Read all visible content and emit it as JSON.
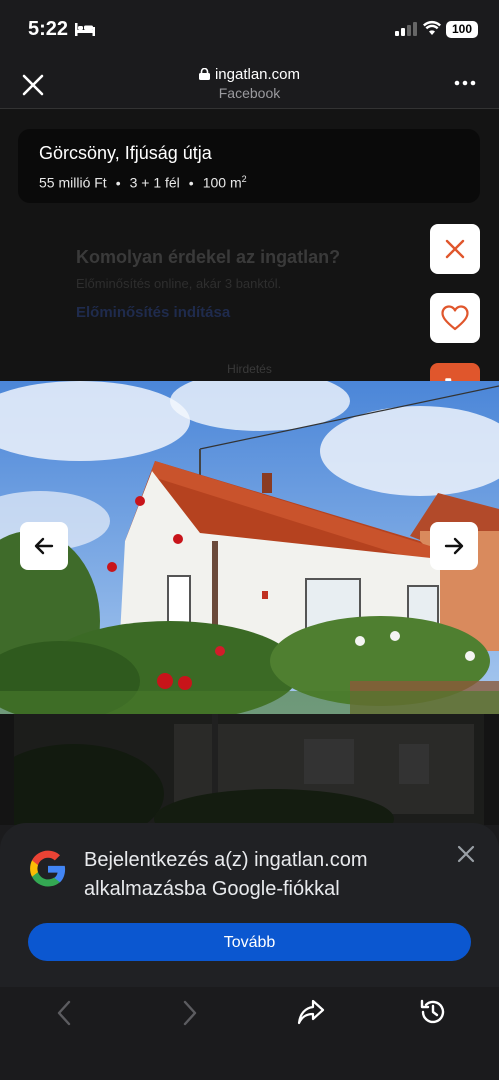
{
  "status_bar": {
    "time": "5:22",
    "battery": "100"
  },
  "browser": {
    "url": "ingatlan.com",
    "source": "Facebook"
  },
  "listing": {
    "title": "Görcsöny, Ifjúság útja",
    "price": "55 millió Ft",
    "rooms": "3 + 1 fél",
    "area": "100 m",
    "area_sup": "2"
  },
  "background_page": {
    "heading": "Komolyan érdekel az ingatlan?",
    "subtext": "Előminősítés online, akár 3 banktól.",
    "link": "Előminősítés indítása",
    "ad_label": "Hirdetés"
  },
  "google_sheet": {
    "message": "Bejelentkezés a(z) ingatlan.com alkalmazásba Google-fiókkal",
    "button": "Tovább"
  },
  "colors": {
    "accent_orange": "#e0562c",
    "google_blue": "#0b57d0"
  },
  "icons": [
    "close-icon",
    "lock-icon",
    "more-icon",
    "close-orange-icon",
    "heart-icon",
    "phone-icon",
    "arrow-left-icon",
    "arrow-right-icon",
    "google-logo-icon",
    "back-icon",
    "forward-icon",
    "share-icon",
    "history-icon"
  ]
}
